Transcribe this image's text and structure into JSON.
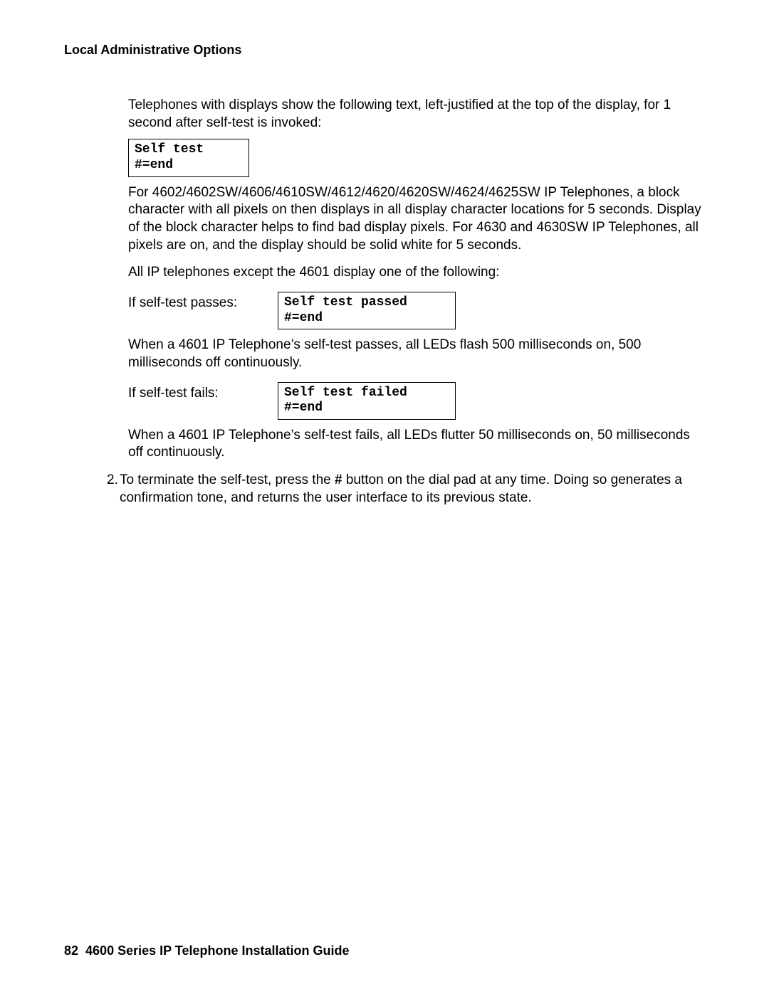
{
  "header": {
    "title": "Local Administrative Options"
  },
  "content": {
    "intro": "Telephones with displays show the following text, left-justified at the top of the display, for 1 second after self-test is invoked:",
    "box1": "Self test\n#=end",
    "para_block": "For 4602/4602SW/4606/4610SW/4612/4620/4620SW/4624/4625SW IP Telephones, a block character with all pixels on then displays in all display character locations for 5 seconds. Display of the block character helps to find bad display pixels. For 4630 and 4630SW IP Telephones, all pixels are on, and the display should be solid white for 5 seconds.",
    "para_all": "All IP telephones except the 4601 display one of the following:",
    "pass": {
      "label": "If self-test passes:",
      "box": "Self test passed\n#=end"
    },
    "para_pass": "When a 4601 IP Telephone’s self-test passes, all LEDs flash 500 milliseconds on, 500 milliseconds off continuously.",
    "fail": {
      "label": "If self-test fails:",
      "box": "Self test failed\n#=end"
    },
    "para_fail": "When a 4601 IP Telephone’s self-test fails, all LEDs flutter 50 milliseconds on, 50 milliseconds off continuously.",
    "step2": {
      "num": "2.",
      "t1": "To terminate the self-test, press the ",
      "bold": "#",
      "t2": " button on the dial pad at any time. Doing so generates a confirmation tone, and returns the user interface to its previous state."
    }
  },
  "footer": {
    "page": "82",
    "title": "4600 Series IP Telephone Installation Guide"
  }
}
